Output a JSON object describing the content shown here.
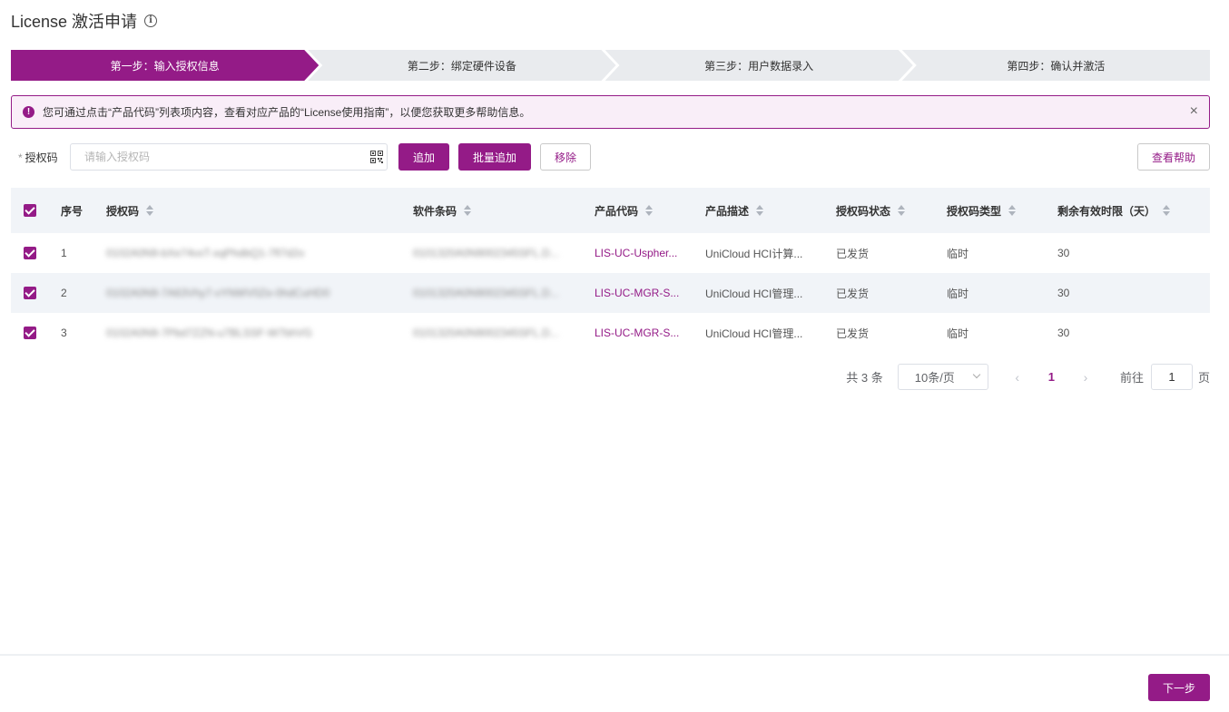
{
  "page": {
    "title": "License 激活申请",
    "info_icon": "info-circle-icon"
  },
  "steps": [
    {
      "label": "第一步：输入授权信息",
      "active": true
    },
    {
      "label": "第二步：绑定硬件设备",
      "active": false
    },
    {
      "label": "第三步：用户数据录入",
      "active": false
    },
    {
      "label": "第四步：确认并激活",
      "active": false
    }
  ],
  "alert": {
    "icon": "exclamation-icon",
    "text": "您可通过点击“产品代码”列表项内容，查看对应产品的“License使用指南”，以便您获取更多帮助信息。",
    "close": "×"
  },
  "form": {
    "required_mark": "*",
    "label": "授权码",
    "placeholder": "请输入授权码",
    "add_label": "追加",
    "batch_add_label": "批量追加",
    "remove_label": "移除",
    "help_label": "查看帮助"
  },
  "table": {
    "columns": [
      "序号",
      "授权码",
      "软件条码",
      "产品代码",
      "产品描述",
      "授权码状态",
      "授权码类型",
      "剩余有效时限（天）"
    ],
    "rows": [
      {
        "no": "1",
        "code": "0102A0N9-bXe74vxT-xqPhdbQ1-7fl7d2o",
        "sw": "0101320A0N9002345SFL.D...",
        "pc": "LIS-UC-Uspher...",
        "pd": "UniCloud HCI计算...",
        "status": "已发货",
        "type": "临时",
        "days": "30"
      },
      {
        "no": "2",
        "code": "0102A0N9-7A63Vhy7-vYNWV0Ze-0hdCuHD0",
        "sw": "0101320A0N9002345SFL.D...",
        "pc": "LIS-UC-MGR-S...",
        "pd": "UniCloud HCI管理...",
        "status": "已发货",
        "type": "临时",
        "days": "30"
      },
      {
        "no": "3",
        "code": "0102A0N9-7Pbd7ZZN-u7BLSSF-W7bhVG",
        "sw": "0101320A0N9002345SFL.D...",
        "pc": "LIS-UC-MGR-S...",
        "pd": "UniCloud HCI管理...",
        "status": "已发货",
        "type": "临时",
        "days": "30"
      }
    ]
  },
  "pagination": {
    "total": "共 3 条",
    "page_size": "10条/页",
    "current_page": "1",
    "goto_label": "前往",
    "goto_value": "1",
    "page_unit": "页"
  },
  "footer": {
    "next_label": "下一步"
  },
  "colors": {
    "accent": "#941b87",
    "alert_bg": "#f9eef8",
    "table_header_bg": "#f1f4f8"
  }
}
